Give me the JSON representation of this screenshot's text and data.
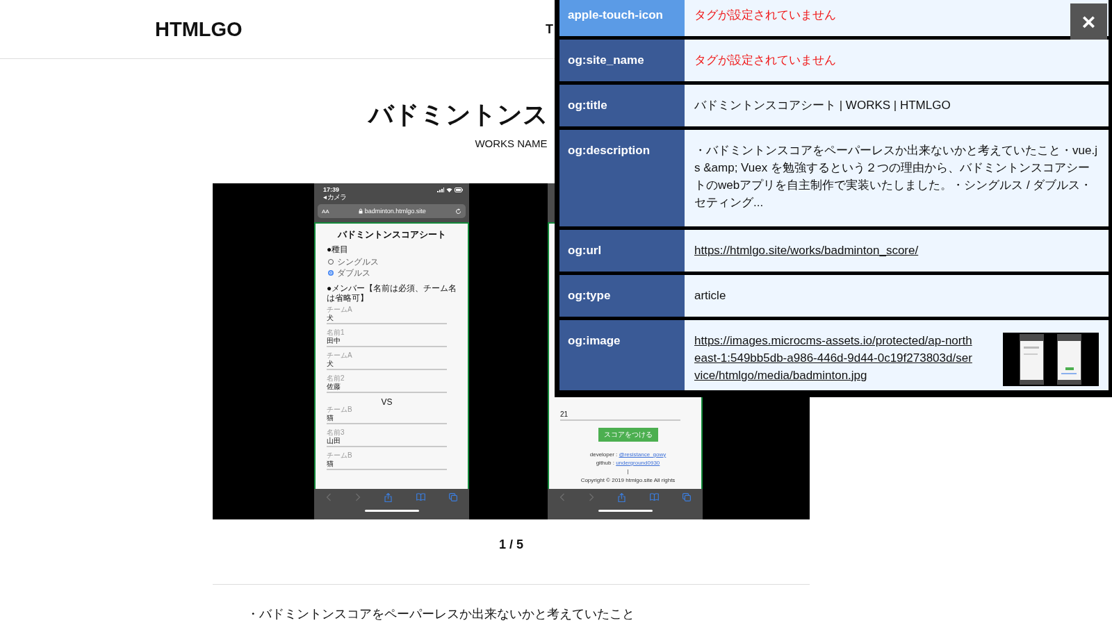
{
  "header": {
    "logo": "HTMLGO",
    "nav": [
      {
        "label": "T"
      }
    ]
  },
  "work": {
    "title": "バドミントンス",
    "subtitle": "WORKS NAME"
  },
  "slider": {
    "slides": [
      {
        "status": {
          "time": "17:39",
          "back": "◂ カメラ"
        },
        "address": {
          "text_size": "AA",
          "url": "badminton.htmlgo.site"
        },
        "items": [
          {
            "kind": "heading",
            "text": "バドミントンスコアシート"
          },
          {
            "kind": "section",
            "text": "●種目"
          },
          {
            "kind": "radio",
            "label": "シングルス",
            "checked": false
          },
          {
            "kind": "radio",
            "label": "ダブルス",
            "checked": true
          },
          {
            "kind": "section",
            "text": "●メンバー【名前は必須、チーム名は省略可】"
          },
          {
            "kind": "field",
            "label": "チームA",
            "value": "犬"
          },
          {
            "kind": "field",
            "label": "名前1",
            "value": "田中"
          },
          {
            "kind": "field",
            "label": "チームA",
            "value": "犬"
          },
          {
            "kind": "field",
            "label": "名前2",
            "value": "佐藤"
          },
          {
            "kind": "vs",
            "text": "VS"
          },
          {
            "kind": "field",
            "label": "チームB",
            "value": "猫"
          },
          {
            "kind": "field",
            "label": "名前3",
            "value": "山田"
          },
          {
            "kind": "field",
            "label": "チームB",
            "value": "猫"
          }
        ]
      },
      {
        "items": [
          {
            "kind": "field",
            "value": "21"
          },
          {
            "kind": "button",
            "text": "スコアをつける"
          },
          {
            "kind": "credit",
            "label": "developer : ",
            "link": "@resistance_gowy"
          },
          {
            "kind": "credit",
            "label": "github : ",
            "link": "underground0930"
          },
          {
            "kind": "note",
            "text": "|"
          },
          {
            "kind": "note",
            "text": "Copyright © 2019 htmlgo.site All rights"
          }
        ]
      }
    ],
    "counter": "1 / 5"
  },
  "description": "・バドミントンスコアをペーパーレスか出来ないかと考えていたこと",
  "ogp_panel": {
    "close": "×",
    "rows": [
      {
        "key": "apple-touch-icon",
        "kind": "missing",
        "value": "タグが設定されていません",
        "highlighted": true
      },
      {
        "key": "og:site_name",
        "kind": "missing",
        "value": "タグが設定されていません",
        "highlighted": false
      },
      {
        "key": "og:title",
        "kind": "text",
        "value": "バドミントンスコアシート | WORKS | HTMLGO",
        "highlighted": false
      },
      {
        "key": "og:description",
        "kind": "text",
        "value": "・バドミントンスコアをペーパーレスか出来ないかと考えていたこと・vue.js &amp; Vuex を勉強するという２つの理由から、バドミントンスコアシートのwebアプリを自主制作で実装いたしました。・シングルス / ダブルス・セティング...",
        "highlighted": false
      },
      {
        "key": "og:url",
        "kind": "link",
        "value": "https://htmlgo.site/works/badminton_score/",
        "highlighted": false
      },
      {
        "key": "og:type",
        "kind": "text",
        "value": "article",
        "highlighted": false
      },
      {
        "key": "og:image",
        "value": "https://images.microcms-assets.io/protected/ap-northeast-1:549bb5db-a986-446d-9d44-0c19f273803d/service/htmlgo/media/badminton.jpg",
        "highlighted": false
      }
    ]
  }
}
